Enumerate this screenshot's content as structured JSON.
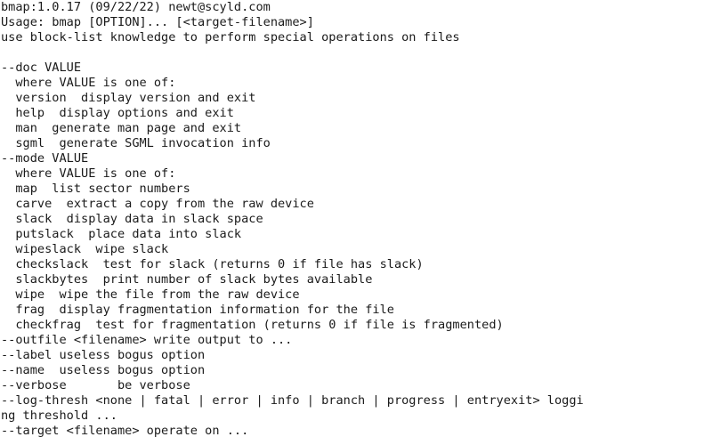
{
  "terminal": {
    "lines": [
      "bmap:1.0.17 (09/22/22) newt@scyld.com",
      "Usage: bmap [OPTION]... [<target-filename>]",
      "use block-list knowledge to perform special operations on files",
      "",
      "--doc VALUE",
      "  where VALUE is one of:",
      "  version  display version and exit",
      "  help  display options and exit",
      "  man  generate man page and exit",
      "  sgml  generate SGML invocation info",
      "--mode VALUE",
      "  where VALUE is one of:",
      "  map  list sector numbers",
      "  carve  extract a copy from the raw device",
      "  slack  display data in slack space",
      "  putslack  place data into slack",
      "  wipeslack  wipe slack",
      "  checkslack  test for slack (returns 0 if file has slack)",
      "  slackbytes  print number of slack bytes available",
      "  wipe  wipe the file from the raw device",
      "  frag  display fragmentation information for the file",
      "  checkfrag  test for fragmentation (returns 0 if file is fragmented)",
      "--outfile <filename> write output to ...",
      "--label useless bogus option",
      "--name  useless bogus option",
      "--verbose       be verbose",
      "--log-thresh <none | fatal | error | info | branch | progress | entryexit> loggi",
      "ng threshold ...",
      "--target <filename> operate on ..."
    ]
  }
}
